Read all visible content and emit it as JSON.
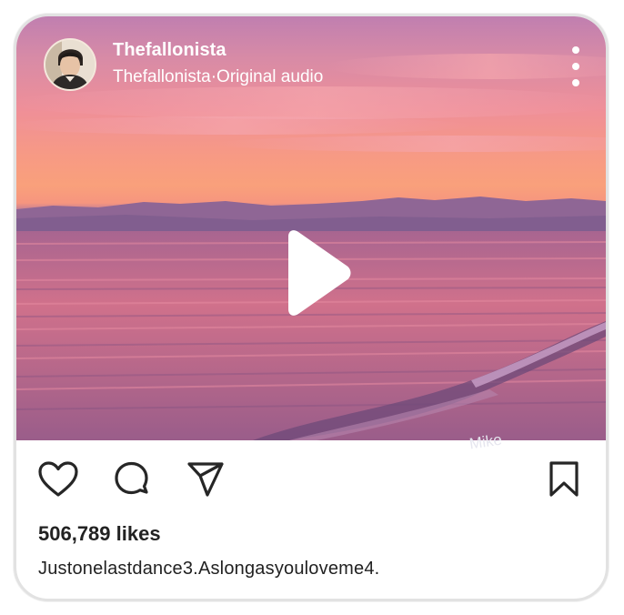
{
  "post": {
    "username": "Thefallonista",
    "audio_line": "Thefallonista·Original audio",
    "likes": "506,789 likes",
    "caption": "Justonelastdance3.Aslongasyouloveme4.",
    "watermark": "Mike"
  },
  "icons": {
    "avatar": "profile-photo",
    "more": "vertical-ellipsis-icon",
    "play": "play-icon",
    "like": "heart-icon",
    "comment": "comment-icon",
    "share": "paper-plane-icon",
    "save": "bookmark-icon"
  },
  "colors": {
    "sky_top": "#c07fb0",
    "sky_horizon": "#f79a84",
    "sea": "#c86a88",
    "icon_stroke": "#262626",
    "text": "#222222"
  }
}
